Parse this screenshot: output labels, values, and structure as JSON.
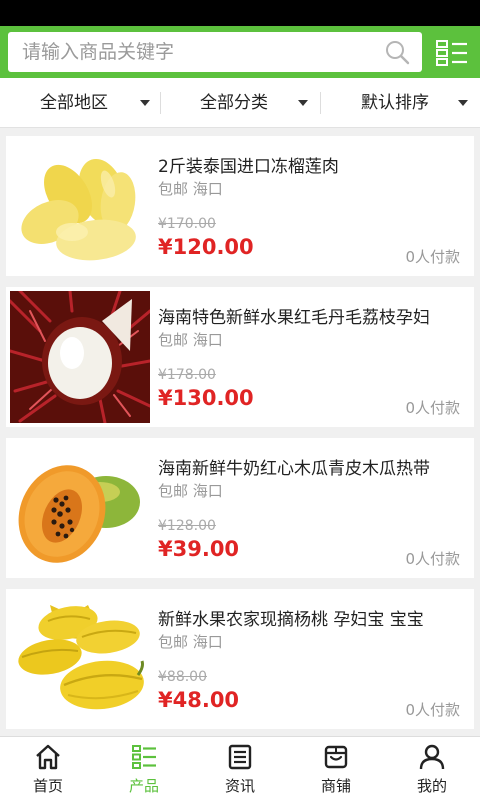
{
  "search": {
    "placeholder": "请输入商品关键字",
    "icon": "search-icon"
  },
  "filters": [
    {
      "label": "全部地区"
    },
    {
      "label": "全部分类"
    },
    {
      "label": "默认排序"
    }
  ],
  "products": [
    {
      "title": "2斤装泰国进口冻榴莲肉",
      "meta": "包邮 海口",
      "old_price": "¥170.00",
      "price": "¥120.00",
      "sold": "0人付款",
      "image": "durian-flesh"
    },
    {
      "title": "海南特色新鲜水果红毛丹毛荔枝孕妇",
      "meta": "包邮 海口",
      "old_price": "¥178.00",
      "price": "¥130.00",
      "sold": "0人付款",
      "image": "rambutan"
    },
    {
      "title": "海南新鲜牛奶红心木瓜青皮木瓜热带",
      "meta": "包邮 海口",
      "old_price": "¥128.00",
      "price": "¥39.00",
      "sold": "0人付款",
      "image": "papaya"
    },
    {
      "title": "新鲜水果农家现摘杨桃 孕妇宝 宝宝",
      "meta": "包邮 海口",
      "old_price": "¥88.00",
      "price": "¥48.00",
      "sold": "0人付款",
      "image": "star-fruit"
    }
  ],
  "tabs": [
    {
      "label": "首页",
      "icon": "home-icon"
    },
    {
      "label": "产品",
      "icon": "product-list-icon"
    },
    {
      "label": "资讯",
      "icon": "news-icon"
    },
    {
      "label": "商铺",
      "icon": "shop-icon"
    },
    {
      "label": "我的",
      "icon": "user-icon"
    }
  ],
  "colors": {
    "brand": "#5cc13d",
    "price": "#e02424"
  }
}
